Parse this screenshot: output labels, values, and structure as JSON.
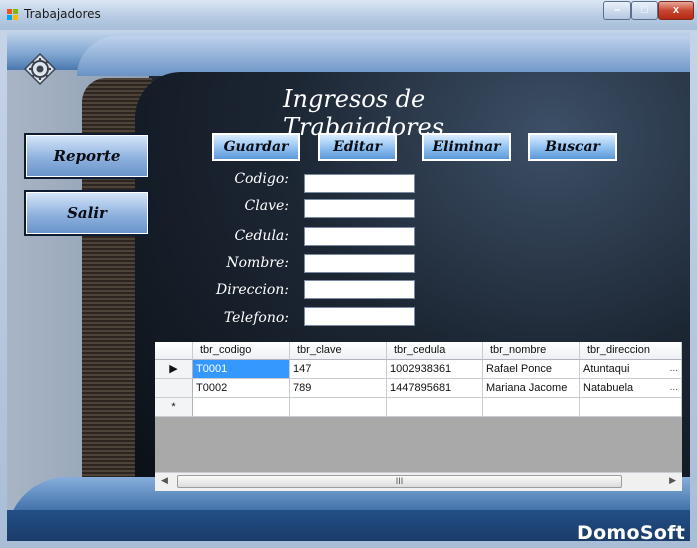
{
  "window": {
    "title": "Trabajadores",
    "min_glyph": "–",
    "max_glyph": "□",
    "close_glyph": "x"
  },
  "header": {
    "title": "Ingresos de Trabajadores"
  },
  "toolbar": {
    "guardar": "Guardar",
    "editar": "Editar",
    "eliminar": "Eliminar",
    "buscar": "Buscar"
  },
  "sidebar": {
    "reporte": "Reporte",
    "salir": "Salir"
  },
  "form": {
    "codigo": {
      "label": "Codigo:",
      "value": ""
    },
    "clave": {
      "label": "Clave:",
      "value": ""
    },
    "cedula": {
      "label": "Cedula:",
      "value": ""
    },
    "nombre": {
      "label": "Nombre:",
      "value": ""
    },
    "direccion": {
      "label": "Direccion:",
      "value": ""
    },
    "telefono": {
      "label": "Telefono:",
      "value": ""
    }
  },
  "grid": {
    "columns": [
      "tbr_codigo",
      "tbr_clave",
      "tbr_cedula",
      "tbr_nombre",
      "tbr_direccion"
    ],
    "rows": [
      [
        "T0001",
        "147",
        "1002938361",
        "Rafael Ponce",
        "Atuntaqui"
      ],
      [
        "T0002",
        "789",
        "1447895681",
        "Mariana Jacome",
        "Natabuela"
      ]
    ],
    "current_row_marker": "▶",
    "new_row_marker": "*",
    "cell_ellipsis": "...",
    "scroll_grip": "III"
  },
  "brand": "DomoSoft",
  "colors": {
    "accent": "#8fc0f0",
    "selection": "#3399ff",
    "panel": "#1c2633"
  }
}
